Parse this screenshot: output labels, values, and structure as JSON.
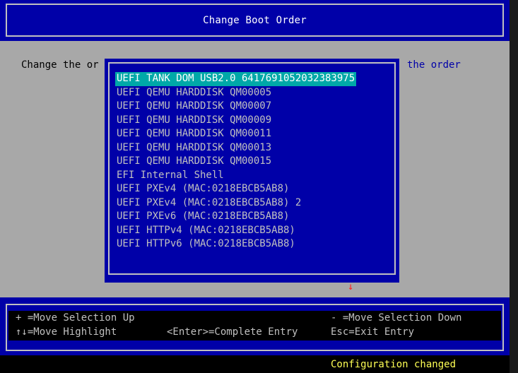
{
  "window": {
    "title": "Change Boot Order"
  },
  "body": {
    "text_left": "Change the or",
    "text_right": "the order"
  },
  "popup": {
    "items": [
      "UEFI TANK DOM USB2.0 6417691052032383975",
      "UEFI QEMU HARDDISK QM00005",
      "UEFI QEMU HARDDISK QM00007",
      "UEFI QEMU HARDDISK QM00009",
      "UEFI QEMU HARDDISK QM00011",
      "UEFI QEMU HARDDISK QM00013",
      "UEFI QEMU HARDDISK QM00015",
      "EFI Internal Shell",
      "UEFI PXEv4 (MAC:0218EBCB5AB8)",
      "UEFI PXEv4 (MAC:0218EBCB5AB8) 2",
      "UEFI PXEv6 (MAC:0218EBCB5AB8)",
      "UEFI HTTPv4 (MAC:0218EBCB5AB8)",
      "UEFI HTTPv6 (MAC:0218EBCB5AB8)"
    ],
    "selected_index": 0,
    "scroll_arrow": "↓",
    "scroll_arrow_icon": "down-arrow-icon"
  },
  "help": {
    "move_up": "+ =Move Selection Up",
    "move_down": "- =Move Selection Down",
    "move_highlight": "↑↓=Move Highlight",
    "complete_entry": "<Enter>=Complete Entry",
    "exit_entry": "Esc=Exit Entry"
  },
  "status": {
    "message": "Configuration changed"
  },
  "colors": {
    "blue": "#0000a8",
    "grey": "#a8a8a8",
    "highlight": "#00a8a8",
    "status_yellow": "#ffff54",
    "arrow_red": "#ff2020"
  }
}
